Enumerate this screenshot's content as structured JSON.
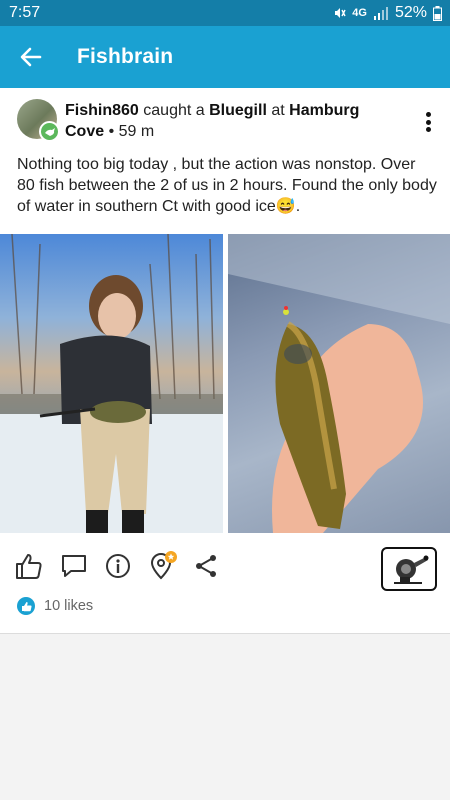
{
  "status_bar": {
    "time": "7:57",
    "network": "4G",
    "battery": "52%"
  },
  "app_bar": {
    "title": "Fishbrain"
  },
  "post": {
    "username": "Fishin860",
    "caught_text": "caught a",
    "species": "Bluegill",
    "at_text": "at",
    "location": "Hamburg Cove",
    "separator": "•",
    "age": "59 m",
    "caption": "Nothing too big today , but the action was nonstop. Over 80 fish between the 2 of us in 2 hours. Found the only body of water in southern Ct with good ice",
    "caption_emoji": "😅",
    "caption_end": ".",
    "likes": "10 likes"
  },
  "icons": [
    "back-arrow-icon",
    "more-vertical-icon",
    "thumbs-up-icon",
    "comment-icon",
    "info-icon",
    "location-pin-icon",
    "share-icon",
    "fishing-reel-icon",
    "like-thumb-icon"
  ],
  "colors": {
    "app_bar": "#1aa1d2",
    "status_bar": "#147ea8",
    "like_accent": "#1aa1d2",
    "badge": "#5cb85c",
    "pin_star": "#f5a623"
  }
}
